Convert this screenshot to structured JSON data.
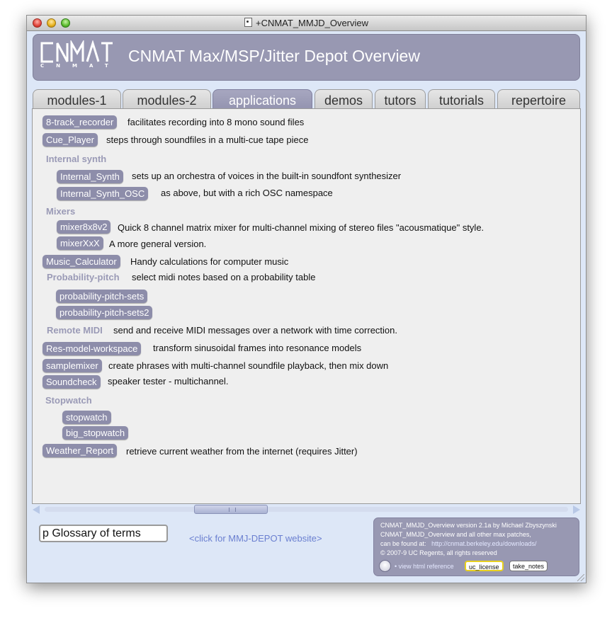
{
  "window": {
    "title": "+CNMAT_MMJD_Overview"
  },
  "header": {
    "logo_letters": "CNMAT",
    "title": "CNMAT Max/MSP/Jitter Depot Overview"
  },
  "tabs": [
    {
      "label": "modules-1",
      "active": false
    },
    {
      "label": "modules-2",
      "active": false
    },
    {
      "label": "applications",
      "active": true
    },
    {
      "label": "demos",
      "active": false
    },
    {
      "label": "tutors",
      "active": false
    },
    {
      "label": "tutorials",
      "active": false
    },
    {
      "label": "repertoire",
      "active": false
    }
  ],
  "apps": {
    "eight_track": {
      "button": "8-track_recorder",
      "desc": "facilitates recording into 8 mono sound files"
    },
    "cue_player": {
      "button": "Cue_Player",
      "desc": "steps through soundfiles in a multi-cue tape piece"
    },
    "internal_synth_heading": "Internal synth",
    "internal_synth": {
      "button": "Internal_Synth",
      "desc": "sets up an orchestra of voices in the built-in soundfont synthesizer"
    },
    "internal_synth_osc": {
      "button": "Internal_Synth_OSC",
      "desc": "as above, but with a rich OSC namespace"
    },
    "mixers_heading": "Mixers",
    "mixer8x8v2": {
      "button": "mixer8x8v2",
      "desc": "Quick 8 channel matrix mixer for multi-channel mixing of stereo files \"acousmatique\" style."
    },
    "mixerxxx": {
      "button": "mixerXxX",
      "desc": "A more general version."
    },
    "music_calculator": {
      "button": "Music_Calculator",
      "desc": "Handy calculations for computer music"
    },
    "probability_heading": "Probability-pitch",
    "probability_desc": "select midi notes based on a probability table",
    "probability_sets": {
      "button": "probability-pitch-sets"
    },
    "probability_sets2": {
      "button": "probability-pitch-sets2"
    },
    "remote_midi_heading": "Remote MIDI",
    "remote_midi_desc": "send and receive MIDI messages over a network with time correction.",
    "res_model": {
      "button": "Res-model-workspace",
      "desc": "transform sinusoidal frames into resonance models"
    },
    "samplemixer": {
      "button": "samplemixer",
      "desc": "create phrases with multi-channel soundfile playback, then mix down"
    },
    "soundcheck": {
      "button": "Soundcheck",
      "desc": "speaker tester - multichannel."
    },
    "stopwatch_heading": "Stopwatch",
    "stopwatch": {
      "button": "stopwatch"
    },
    "big_stopwatch": {
      "button": "big_stopwatch"
    },
    "weather": {
      "button": "Weather_Report",
      "desc": "retrieve current weather from the internet (requires Jitter)"
    }
  },
  "footer": {
    "glossary_value": "p Glossary of terms",
    "website_link": "<click for MMJ-DEPOT website>",
    "info": {
      "line1": "CNMAT_MMJD_Overview version 2.1a by Michael Zbyszynski",
      "line2": "CNMAT_MMJD_Overview and all other max patches,",
      "line3_prefix": "can be found at:",
      "line3_url": "http://cnmat.berkeley.edu/downloads/",
      "line4": "© 2007-9 UC Regents, all rights reserved",
      "view_ref": "• view html reference",
      "license_button": "uc_license",
      "notes_button": "take_notes"
    }
  },
  "colors": {
    "accent": "#9898b2",
    "pill": "#8d8daa",
    "section": "#9a9ab6",
    "link": "#6a7fd0"
  }
}
